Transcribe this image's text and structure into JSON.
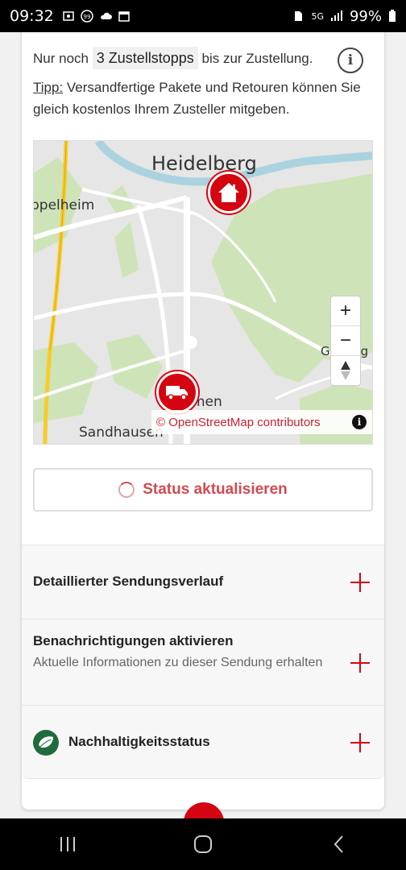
{
  "status_bar": {
    "time": "09:32",
    "network": "5G",
    "battery": "99%",
    "icons": [
      "notification-icon",
      "badge-99-icon",
      "cloud-icon",
      "calendar-icon",
      "sim-icon",
      "signal-icon",
      "battery-icon"
    ]
  },
  "delivery": {
    "stops_prefix": "Nur noch",
    "stops_chip": "3 Zustellstopps",
    "stops_suffix": "bis zur Zustellung.",
    "tip_label": "Tipp:",
    "tip_text": "Versandfertige Pakete und Retouren können Sie gleich kostenlos Ihrem Zusteller mitgeben."
  },
  "map": {
    "labels": {
      "city": "Heidelberg",
      "west": "ppelheim",
      "south": "Sandhausen",
      "east": "Gaiberg",
      "partial": "men"
    },
    "zoom_in": "+",
    "zoom_out": "−",
    "attribution": "© OpenStreetMap contributors",
    "markers": [
      "home-marker",
      "delivery-truck-marker"
    ]
  },
  "refresh_button": {
    "label": "Status aktualisieren"
  },
  "sections": [
    {
      "title": "Detaillierter Sendungsverlauf"
    },
    {
      "title": "Benachrichtigungen aktivieren",
      "subtitle": "Aktuelle Informationen zu dieser Sendung erhalten"
    },
    {
      "title": "Nachhaltigkeitsstatus"
    }
  ],
  "colors": {
    "brand_red": "#d40511",
    "map_green": "#cfe3b9",
    "road_yellow": "#f6cc2a"
  }
}
